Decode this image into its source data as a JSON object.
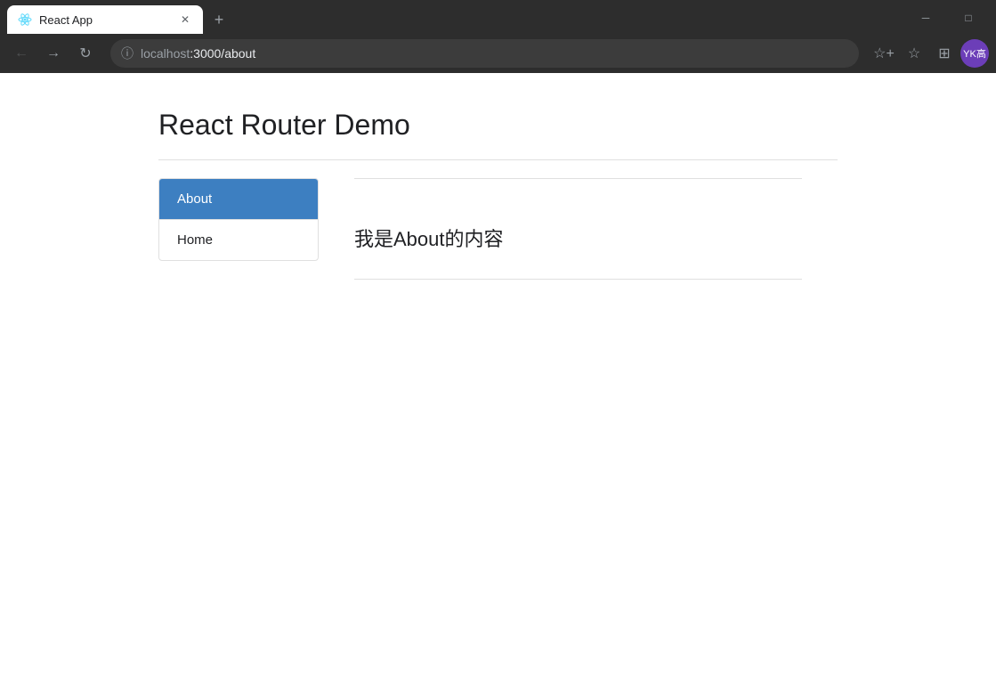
{
  "browser": {
    "tab_title": "React App",
    "tab_icon": "react-icon",
    "url_protocol": "localhost",
    "url_path": ":3000/about",
    "window_minimize": "─",
    "window_maximize": "□",
    "new_tab_icon": "+"
  },
  "toolbar": {
    "back_icon": "←",
    "forward_icon": "→",
    "reload_icon": "↻",
    "info_icon": "ⓘ",
    "favorite_icon": "☆",
    "collections_icon": "⊞",
    "profile_label": "YK高"
  },
  "page": {
    "title": "React Router Demo",
    "nav_items": [
      {
        "label": "About",
        "active": true
      },
      {
        "label": "Home",
        "active": false
      }
    ],
    "content_text": "我是About的内容"
  }
}
